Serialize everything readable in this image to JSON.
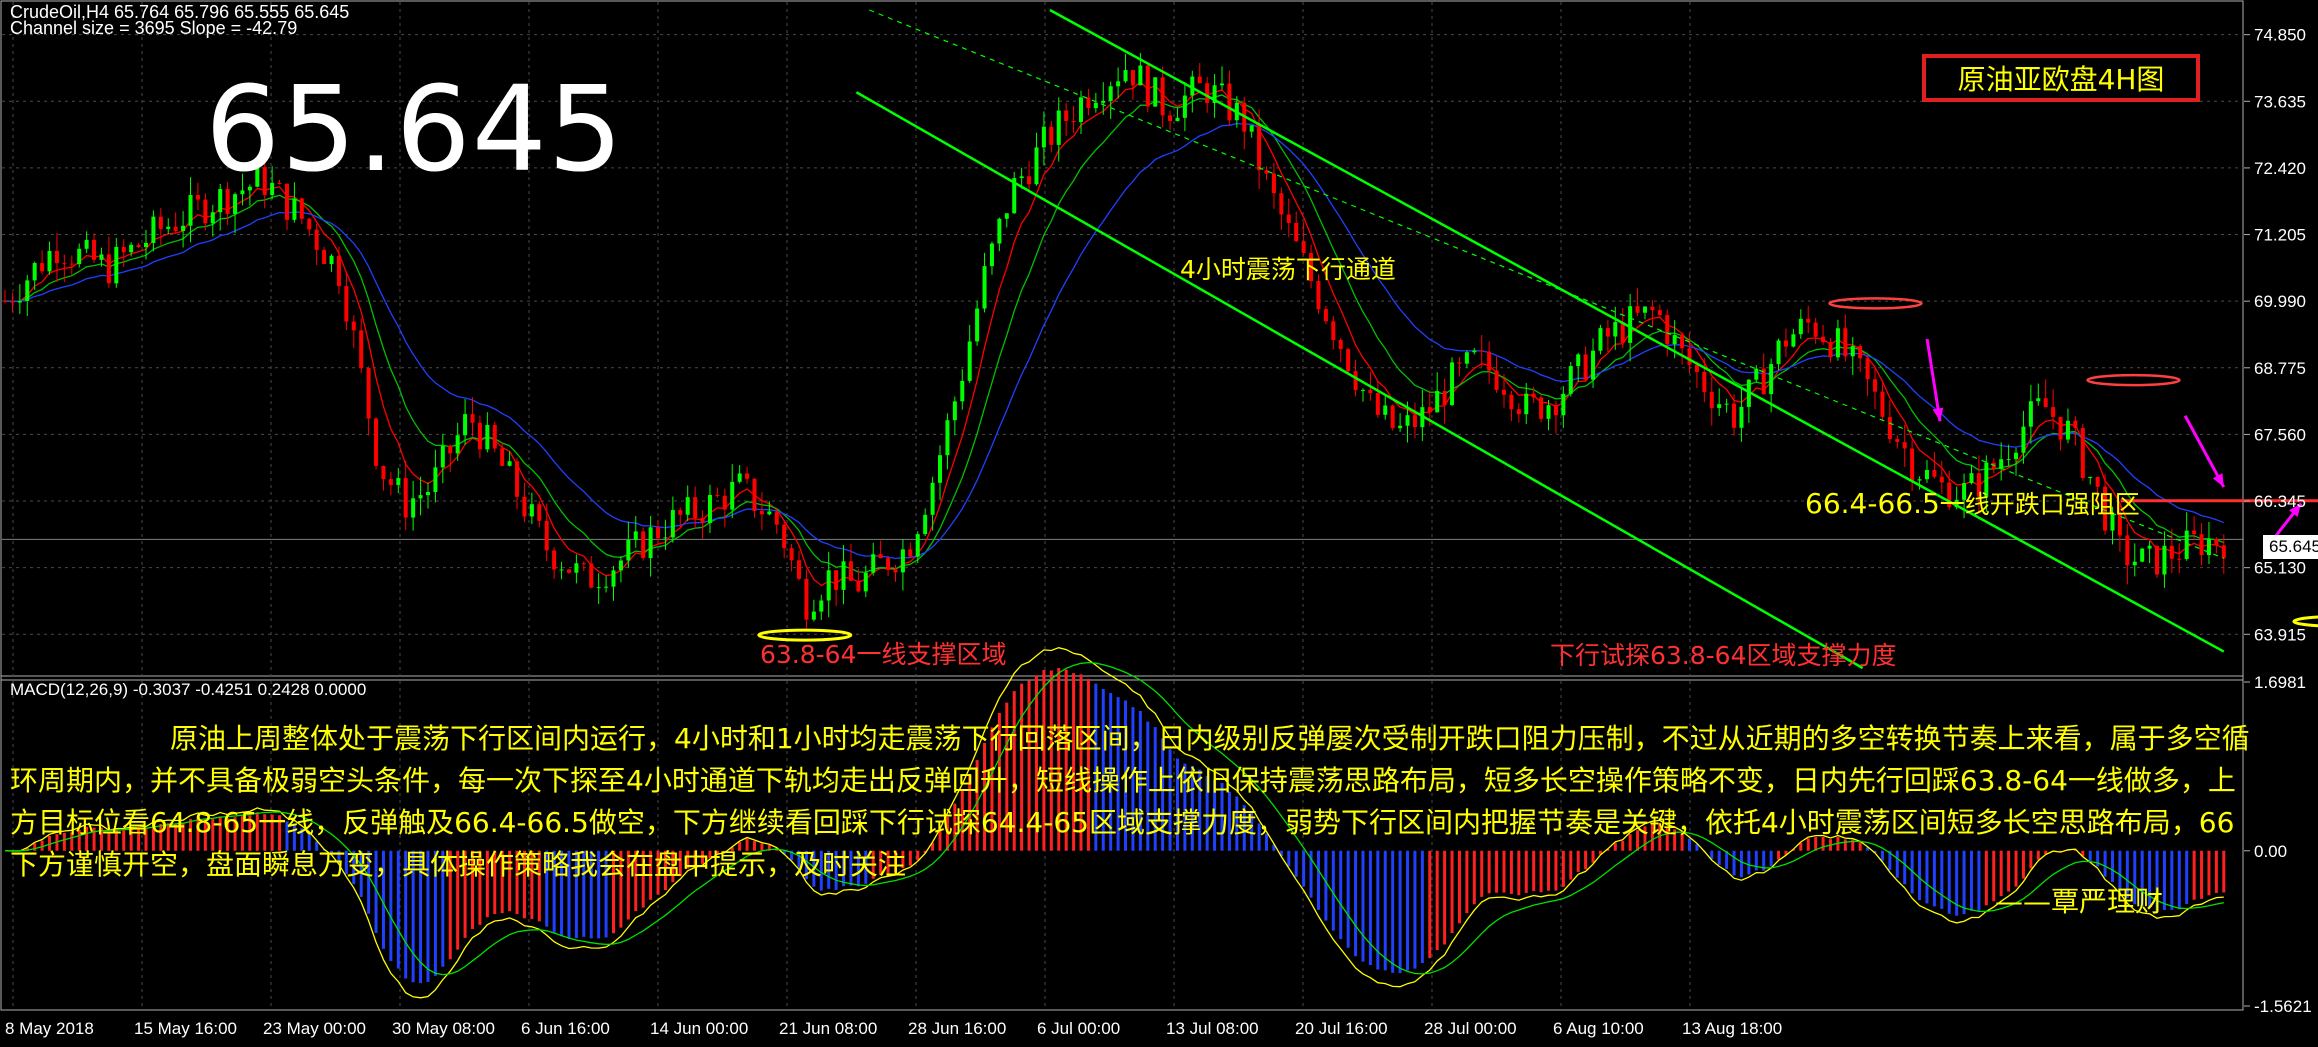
{
  "header": {
    "symbol_line": "CrudeOil,H4  65.764 65.796 65.555 65.645",
    "channel_line": "Channel size = 3695 Slope = -42.79",
    "big_price": "65.645",
    "title_box": "原油亚欧盘4H图"
  },
  "annotations": {
    "channel_label": "4小时震荡下行通道",
    "resistance_label_num": "66.4-66.5",
    "resistance_label_text": "一线开跌口强阻区",
    "support_left_label": "63.8-64一线支撑区域",
    "support_right_label": "下行试探63.8-64区域支撑力度"
  },
  "macd": {
    "label": "MACD(12,26,9) -0.3037 -0.4251 0.2428 0.0000"
  },
  "commentary": "原油上周整体处于震荡下行区间内运行，4小时和1小时均走震荡下行回落区间，日内级别反弹屡次受制开跌口阻力压制，不过从近期的多空转换节奏上来看，属于多空循环周期内，并不具备极弱空头条件，每一次下探至4小时通道下轨均走出反弹回升，短线操作上依旧保持震荡思路布局，短多长空操作策略不变，日内先行回踩63.8-64一线做多，上方目标位看64.8-65一线，反弹触及66.4-66.5做空，下方继续看回踩下行试探64.4-65区域支撑力度，弱势下行区间内把握节奏是关键，依托4小时震荡区间短多长空思路布局，66下方谨慎开空，盘面瞬息万变，具体操作策略我会在盘中提示，及时关注",
  "signature": "——覃严理财",
  "colors": {
    "up_candle": "#00ff00",
    "down_candle": "#ff0000",
    "channel": "#00ff00",
    "ma_fast": "#ff0000",
    "ma_mid": "#00c000",
    "ma_slow": "#2040ff",
    "text_yellow": "#ffff00",
    "arrow": "#ff00ff"
  },
  "chart_data": [
    {
      "type": "candlestick",
      "title": "CrudeOil,H4",
      "x": [
        "8 May 2018",
        "15 May 16:00",
        "23 May 00:00",
        "30 May 08:00",
        "6 Jun 16:00",
        "14 Jun 00:00",
        "21 Jun 08:00",
        "28 Jun 16:00",
        "6 Jul 00:00",
        "13 Jul 08:00",
        "20 Jul 16:00",
        "28 Jul 00:00",
        "6 Aug 10:00",
        "13 Aug 18:00"
      ],
      "y_ticks": [
        "74.850",
        "73.635",
        "72.420",
        "71.205",
        "69.990",
        "68.775",
        "67.560",
        "66.345",
        "65.130",
        "63.915"
      ],
      "ylim": [
        63.3,
        75.3
      ],
      "current_price": "65.645",
      "close_path": [
        [
          0,
          70.0
        ],
        [
          0.4,
          71.0
        ],
        [
          0.8,
          70.6
        ],
        [
          1.2,
          71.3
        ],
        [
          1.6,
          71.8
        ],
        [
          2.0,
          72.2
        ],
        [
          2.3,
          71.5
        ],
        [
          2.6,
          70.5
        ],
        [
          2.9,
          67.0
        ],
        [
          3.1,
          66.3
        ],
        [
          3.3,
          66.6
        ],
        [
          3.6,
          67.9
        ],
        [
          3.9,
          66.8
        ],
        [
          4.2,
          65.5
        ],
        [
          4.5,
          64.9
        ],
        [
          4.8,
          65.3
        ],
        [
          5.1,
          65.9
        ],
        [
          5.4,
          66.2
        ],
        [
          5.7,
          66.6
        ],
        [
          6.0,
          65.9
        ],
        [
          6.2,
          64.5
        ],
        [
          6.4,
          65.0
        ],
        [
          6.6,
          64.8
        ],
        [
          6.8,
          65.2
        ],
        [
          7.0,
          65.5
        ],
        [
          7.2,
          66.8
        ],
        [
          7.4,
          68.5
        ],
        [
          7.6,
          70.5
        ],
        [
          7.8,
          72.0
        ],
        [
          8.1,
          73.0
        ],
        [
          8.4,
          73.8
        ],
        [
          8.7,
          74.3
        ],
        [
          9.0,
          73.5
        ],
        [
          9.3,
          73.9
        ],
        [
          9.6,
          73.3
        ],
        [
          9.8,
          72.0
        ],
        [
          10.0,
          71.0
        ],
        [
          10.2,
          70.0
        ],
        [
          10.4,
          69.0
        ],
        [
          10.6,
          68.0
        ],
        [
          10.8,
          67.6
        ],
        [
          11.0,
          67.9
        ],
        [
          11.2,
          68.5
        ],
        [
          11.4,
          68.9
        ],
        [
          11.6,
          68.6
        ],
        [
          11.8,
          68.0
        ],
        [
          12.0,
          68.2
        ],
        [
          12.2,
          68.7
        ],
        [
          12.4,
          69.3
        ],
        [
          12.6,
          69.6
        ],
        [
          12.8,
          69.8
        ],
        [
          13.0,
          69.0
        ],
        [
          13.2,
          68.4
        ],
        [
          13.4,
          67.9
        ],
        [
          13.6,
          68.5
        ],
        [
          13.8,
          69.3
        ],
        [
          14.0,
          69.6
        ],
        [
          14.2,
          69.2
        ],
        [
          14.4,
          68.6
        ],
        [
          14.6,
          67.8
        ],
        [
          14.8,
          67.0
        ],
        [
          15.0,
          66.6
        ],
        [
          15.2,
          66.5
        ],
        [
          15.4,
          66.9
        ],
        [
          15.6,
          67.6
        ],
        [
          15.8,
          68.1
        ],
        [
          16.0,
          67.6
        ],
        [
          16.2,
          66.6
        ],
        [
          16.4,
          65.4
        ],
        [
          16.6,
          65.2
        ],
        [
          16.8,
          65.4
        ],
        [
          17.0,
          65.6
        ],
        [
          17.2,
          65.645
        ]
      ]
    },
    {
      "type": "macd",
      "title": "MACD(12,26,9)",
      "values": {
        "macd": -0.3037,
        "signal": -0.4251,
        "histogram": 0.2428
      },
      "y_ticks": [
        "1.6981",
        "0.00",
        "-1.5621"
      ],
      "ylim": [
        -1.5621,
        1.6981
      ]
    }
  ]
}
